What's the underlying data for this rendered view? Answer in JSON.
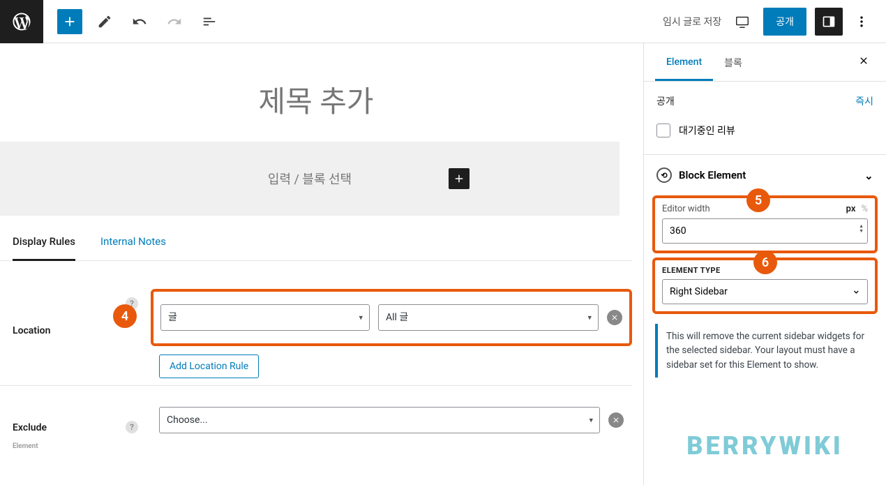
{
  "topbar": {
    "save_draft": "임시 글로 저장",
    "publish": "공개"
  },
  "editor": {
    "title_placeholder": "제목 추가",
    "block_placeholder": "입력 / 블록 선택"
  },
  "tabs": {
    "display_rules": "Display Rules",
    "internal_notes": "Internal Notes"
  },
  "rules": {
    "location_label": "Location",
    "location_type": "글",
    "location_target": "All 글",
    "add_rule": "Add Location Rule",
    "exclude_label": "Exclude",
    "exclude_placeholder": "Choose..."
  },
  "sidebar": {
    "tab_element": "Element",
    "tab_block": "블록",
    "visibility_label": "공개",
    "visibility_value": "즉시",
    "pending_review": "대기중인 리뷰",
    "block_element_panel": "Block Element",
    "editor_width_label": "Editor width",
    "editor_width_value": "360",
    "unit_px": "px",
    "unit_pct": "%",
    "element_type_label": "ELEMENT TYPE",
    "element_type_value": "Right Sidebar",
    "notice": "This will remove the current sidebar widgets for the selected sidebar. Your layout must have a sidebar set for this Element to show."
  },
  "badges": {
    "b4": "4",
    "b5": "5",
    "b6": "6"
  },
  "watermark": "BERRYWIKI"
}
